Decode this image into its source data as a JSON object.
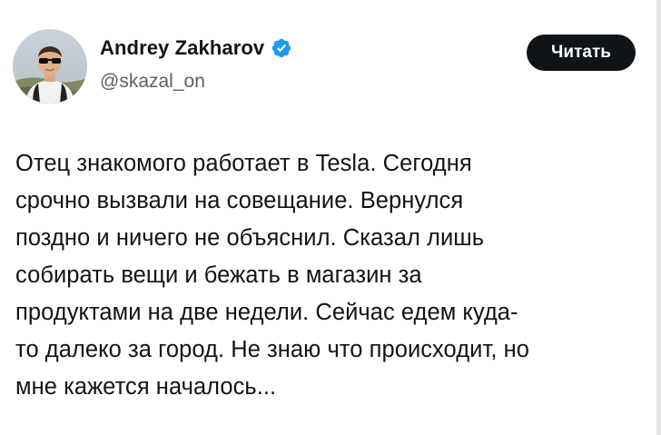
{
  "author": {
    "name": "Andrey Zakharov",
    "handle": "@skazal_on",
    "verified": true,
    "verified_color": "#1d9bf0"
  },
  "actions": {
    "read_label": "Читать"
  },
  "tweet": {
    "lines": [
      "Отец знакомого работает в Tesla. Сегодня",
      "срочно вызвали на совещание. Вернулся",
      "поздно и ничего не объяснил. Сказал лишь",
      "собирать вещи и бежать в магазин за",
      "продуктами на две недели. Сейчас едем куда-",
      "то далеко за город. Не знаю что происходит, но",
      "мне кажется началось..."
    ]
  },
  "icons": {
    "verified": "verified-badge-icon",
    "avatar": "avatar-photo"
  }
}
